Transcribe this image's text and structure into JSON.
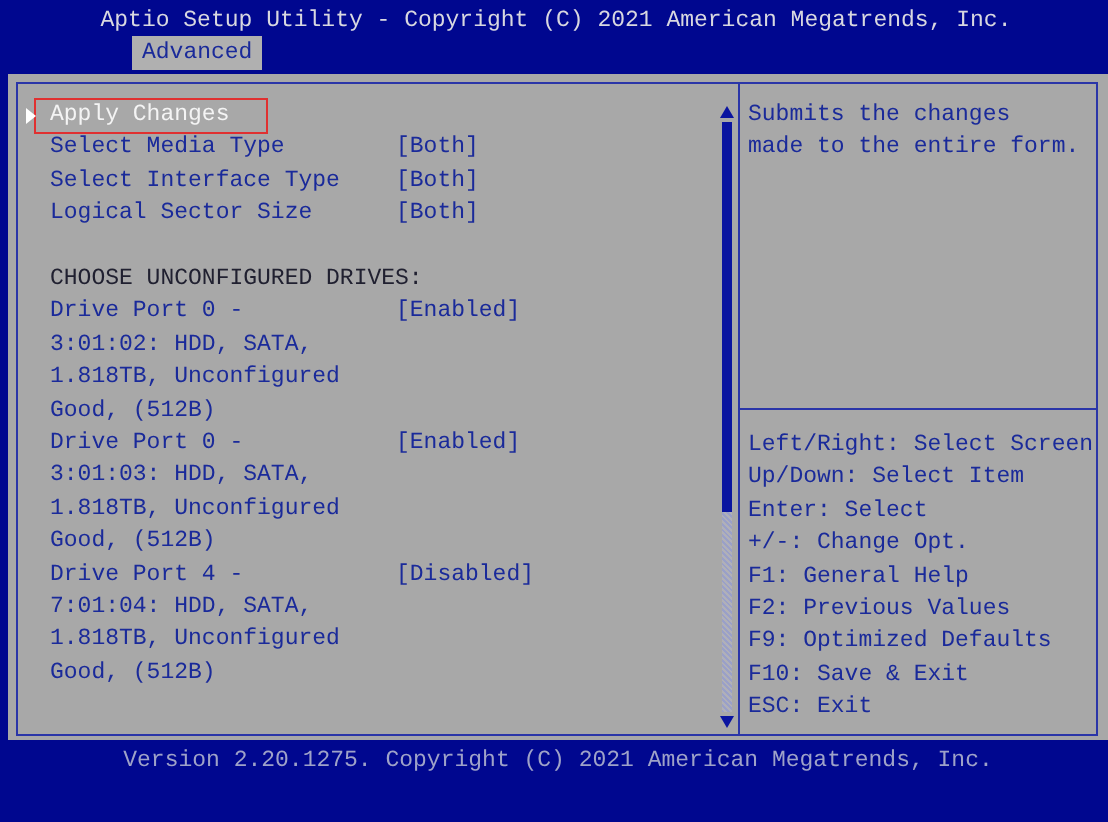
{
  "window": {
    "title": "Aptio Setup Utility - Copyright (C) 2021 American Megatrends, Inc."
  },
  "tabs": [
    {
      "label": "Advanced",
      "selected": true
    }
  ],
  "items": [
    {
      "kind": "action",
      "label_lines": [
        "Apply Changes"
      ],
      "selected": true
    },
    {
      "kind": "option",
      "label_lines": [
        "Select Media Type"
      ],
      "value": "[Both]",
      "selected": false
    },
    {
      "kind": "option",
      "label_lines": [
        "Select Interface Type"
      ],
      "value": "[Both]",
      "selected": false
    },
    {
      "kind": "option",
      "label_lines": [
        "Logical Sector Size"
      ],
      "value": "[Both]",
      "selected": false
    },
    {
      "kind": "blank"
    },
    {
      "kind": "heading",
      "label_lines": [
        "CHOOSE UNCONFIGURED DRIVES:"
      ]
    },
    {
      "kind": "option",
      "label_lines": [
        "Drive Port 0 -",
        "3:01:02: HDD, SATA,",
        "1.818TB, Unconfigured",
        "Good, (512B)"
      ],
      "value": "[Enabled]",
      "selected": false
    },
    {
      "kind": "option",
      "label_lines": [
        "Drive Port 0 -",
        "3:01:03: HDD, SATA,",
        "1.818TB, Unconfigured",
        "Good, (512B)"
      ],
      "value": "[Enabled]",
      "selected": false
    },
    {
      "kind": "option",
      "label_lines": [
        "Drive Port 4 -",
        "7:01:04: HDD, SATA,",
        "1.818TB, Unconfigured",
        "Good, (512B)"
      ],
      "value": "[Disabled]",
      "selected": false
    }
  ],
  "help_lines": [
    "Submits the changes",
    "made to the entire form."
  ],
  "key_legend": [
    "Left/Right: Select Screen",
    "Up/Down: Select Item",
    "Enter: Select",
    "+/-: Change Opt.",
    "F1: General Help",
    "F2: Previous Values",
    "F9: Optimized Defaults",
    "F10: Save & Exit",
    "ESC: Exit"
  ],
  "status_bar": "Version 2.20.1275. Copyright (C) 2021 American Megatrends, Inc."
}
